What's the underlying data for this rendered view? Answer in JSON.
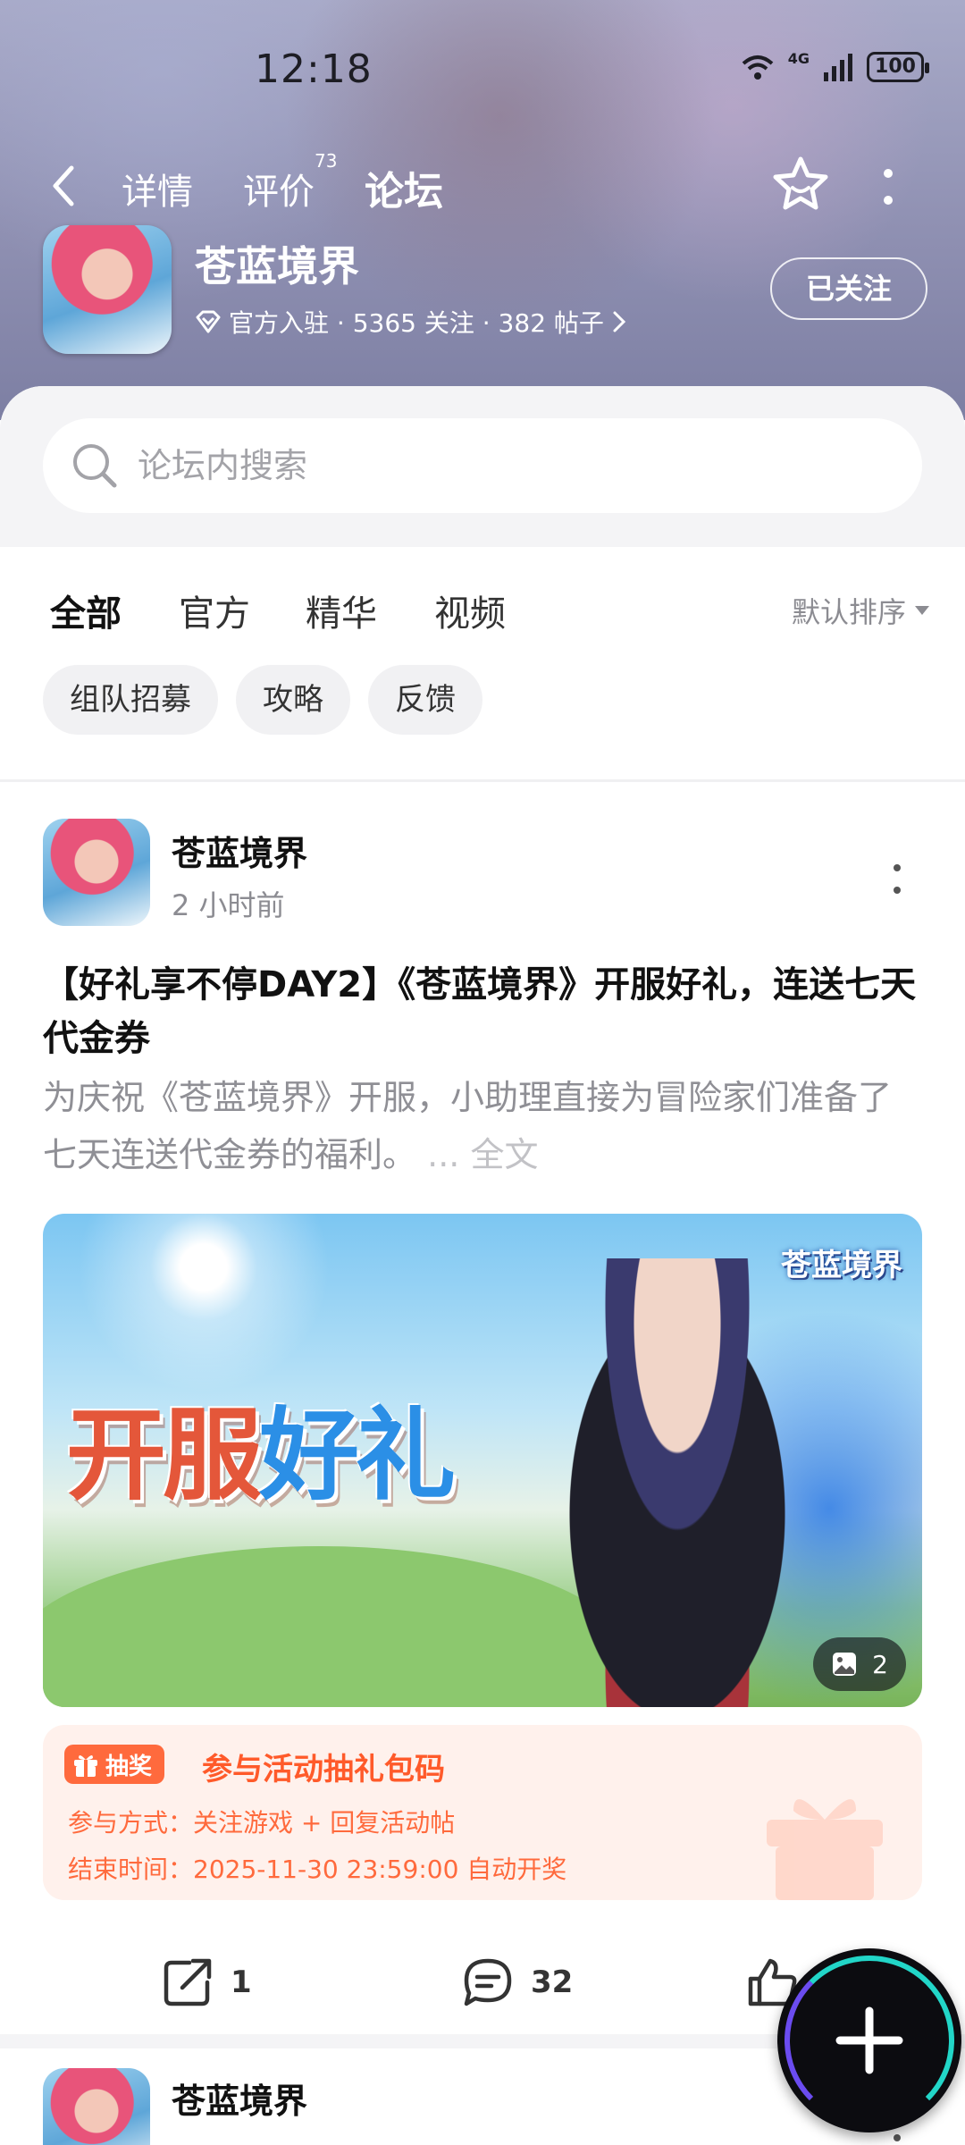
{
  "status_bar": {
    "time": "12:18",
    "network": "4G",
    "battery": "100"
  },
  "top_nav": {
    "tabs": [
      {
        "label": "详情"
      },
      {
        "label": "评价",
        "badge": "73"
      },
      {
        "label": "论坛"
      }
    ],
    "active_tab": "论坛"
  },
  "game": {
    "name": "苍蓝境界",
    "meta": "官方入驻 · 5365 关注 · 382 帖子",
    "follow_label": "已关注"
  },
  "search": {
    "placeholder": "论坛内搜索"
  },
  "categories": {
    "items": [
      "全部",
      "官方",
      "精华",
      "视频"
    ],
    "active": "全部",
    "sort_label": "默认排序"
  },
  "chips": [
    "组队招募",
    "攻略",
    "反馈"
  ],
  "post": {
    "author": "苍蓝境界",
    "time": "2 小时前",
    "title": "【好礼享不停DAY2】《苍蓝境界》开服好礼，连送七天代金券",
    "body": "为庆祝《苍蓝境界》开服，小助理直接为冒险家们准备了七天连送代金券的福利。",
    "ellipsis": "...",
    "read_more": "全文",
    "banner": {
      "text_red": "开服",
      "text_blue": "好礼",
      "logo": "苍蓝境界",
      "image_count": "2"
    },
    "lottery": {
      "tag": "抽奖",
      "title": "参与活动抽礼包码",
      "method": "参与方式：关注游戏 + 回复活动帖",
      "end_time": "结束时间：2025-11-30 23:59:00 自动开奖"
    },
    "actions": {
      "shares": "1",
      "comments": "32",
      "likes": ""
    }
  },
  "post2": {
    "author": "苍蓝境界"
  },
  "colors": {
    "accent": "#27d8c8",
    "lottery": "#ff6a3d"
  }
}
